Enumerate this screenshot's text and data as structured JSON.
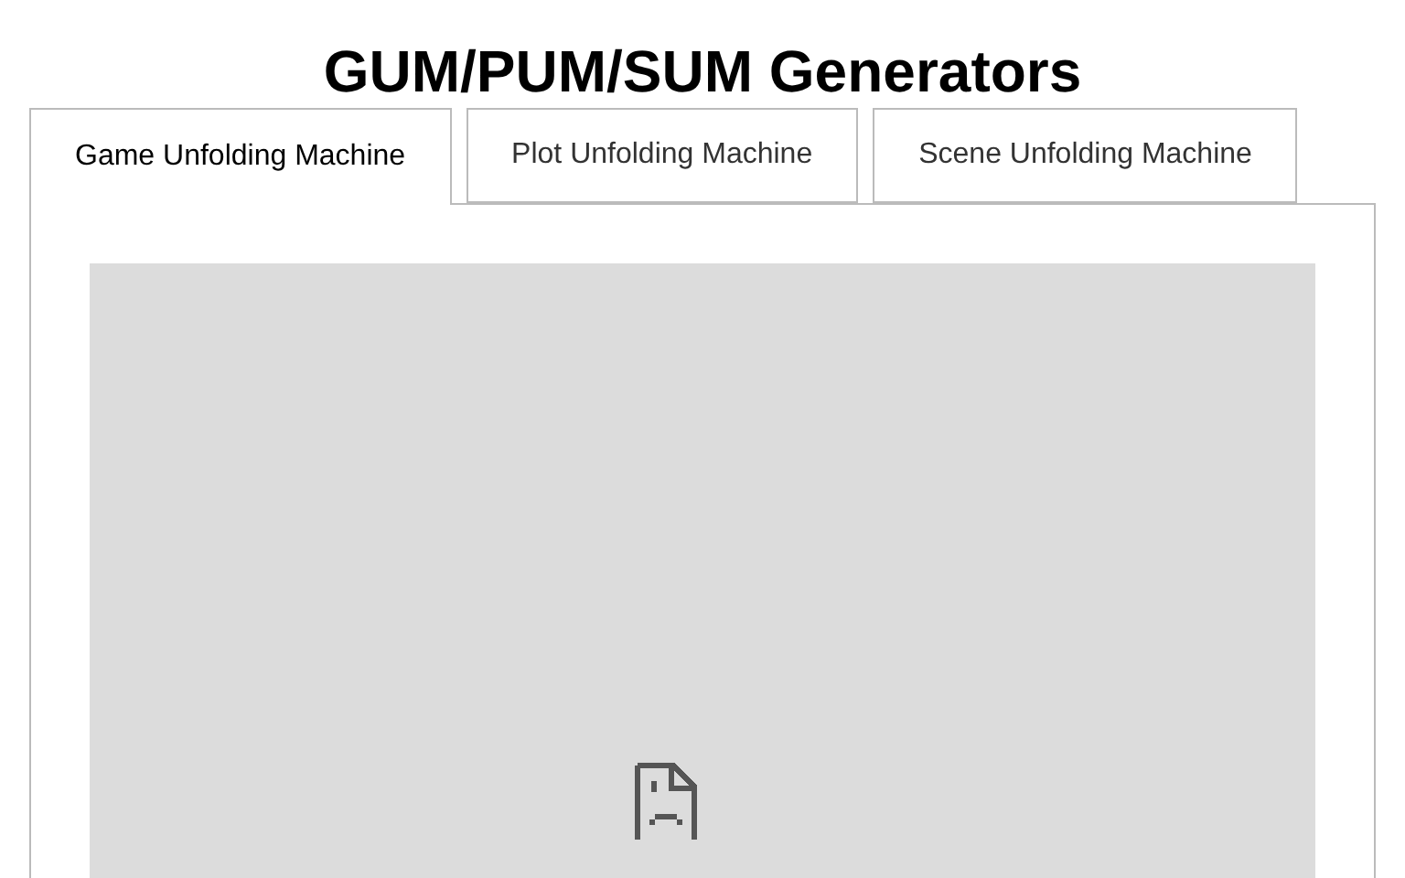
{
  "title": "GUM/PUM/SUM Generators",
  "tabs": [
    {
      "label": "Game Unfolding Machine",
      "selected": true
    },
    {
      "label": "Plot Unfolding Machine",
      "selected": false
    },
    {
      "label": "Scene Unfolding Machine",
      "selected": false
    }
  ],
  "frame": {
    "kind": "failed"
  }
}
